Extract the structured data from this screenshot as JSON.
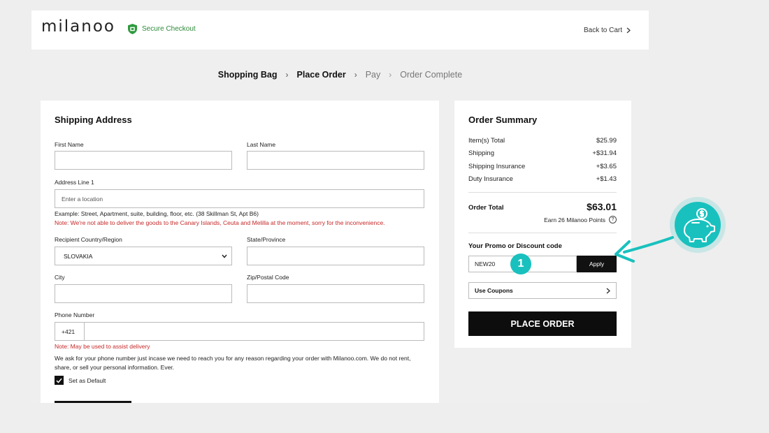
{
  "header": {
    "logo": "milanoo",
    "secure_checkout": "Secure Checkout",
    "back_to_cart": "Back to Cart"
  },
  "steps": [
    "Shopping Bag",
    "Place Order",
    "Pay",
    "Order Complete"
  ],
  "shipping": {
    "title": "Shipping Address",
    "first_name_label": "First Name",
    "last_name_label": "Last Name",
    "address_label": "Address Line 1",
    "address_placeholder": "Enter a location",
    "address_example": "Example: Street, Apartment, suite, building, floor, etc. (38 Skillman St, Apt B6)",
    "address_note": "Note: We're not able to deliver the goods to the Canary Islands,  Ceuta and Melilla at the moment, sorry for the inconvenience.",
    "country_label": "Recipient Country/Region",
    "country_value": "SLOVAKIA",
    "state_label": "State/Province",
    "city_label": "City",
    "zip_label": "Zip/Postal Code",
    "phone_label": "Phone Number",
    "phone_prefix": "+421",
    "phone_note": "Note: May be used to assist delivery",
    "phone_info": "We ask for your phone number just incase we need to reach you for any reason regarding your order with Milanoo.com. We do not rent, share, or sell your personal information. Ever.",
    "set_default_label": "Set as Default"
  },
  "summary": {
    "title": "Order Summary",
    "rows": [
      {
        "label": "Item(s) Total",
        "value": "$25.99"
      },
      {
        "label": "Shipping",
        "value": "+$31.94"
      },
      {
        "label": "Shipping Insurance",
        "value": "+$3.65"
      },
      {
        "label": "Duty Insurance",
        "value": "+$1.43"
      }
    ],
    "total_label": "Order Total",
    "total_value": "$63.01",
    "points_text": "Earn 26 Milanoo Points",
    "promo_label": "Your Promo or Discount code",
    "promo_value": "NEW20",
    "apply_label": "Apply",
    "coupons_label": "Use Coupons",
    "place_order_label": "PLACE ORDER"
  },
  "annotation": {
    "badge": "1"
  },
  "colors": {
    "accent_teal": "#19c1be",
    "secure_green": "#2e8b3a",
    "note_red": "#c62828"
  }
}
